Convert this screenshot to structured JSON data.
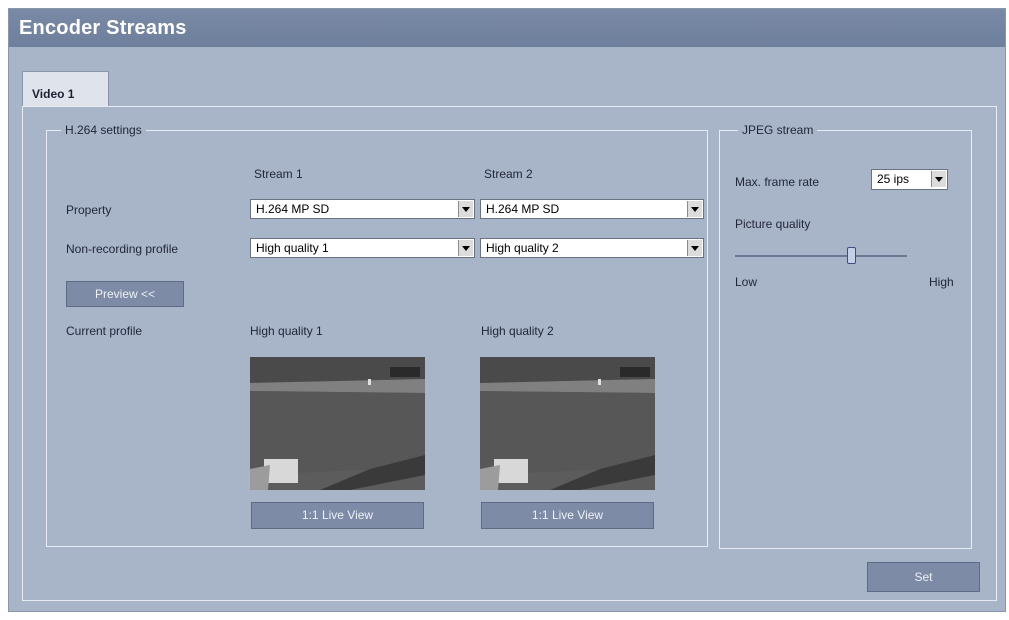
{
  "window": {
    "title": "Encoder Streams"
  },
  "tabs": [
    {
      "label": "Video 1",
      "active": true
    }
  ],
  "h264": {
    "legend": "H.264 settings",
    "stream1_header": "Stream 1",
    "stream2_header": "Stream 2",
    "property_label": "Property",
    "property_stream1": "H.264 MP SD",
    "property_stream2": "H.264 MP SD",
    "nonrec_label": "Non-recording profile",
    "nonrec_stream1": "High quality 1",
    "nonrec_stream2": "High quality 2",
    "preview_button": "Preview <<",
    "current_profile_label": "Current profile",
    "current_stream1": "High quality 1",
    "current_stream2": "High quality 2",
    "live_view_1": "1:1 Live View",
    "live_view_2": "1:1 Live View"
  },
  "jpeg": {
    "legend": "JPEG stream",
    "max_frame_rate_label": "Max. frame rate",
    "max_frame_rate_value": "25 ips",
    "picture_quality_label": "Picture quality",
    "quality_low": "Low",
    "quality_high": "High",
    "quality_level": 0.68
  },
  "set_button": "Set",
  "colors": {
    "window_bg": "#a8b4c8",
    "titlebar": "#7082a0",
    "button": "#7d8ba6"
  }
}
